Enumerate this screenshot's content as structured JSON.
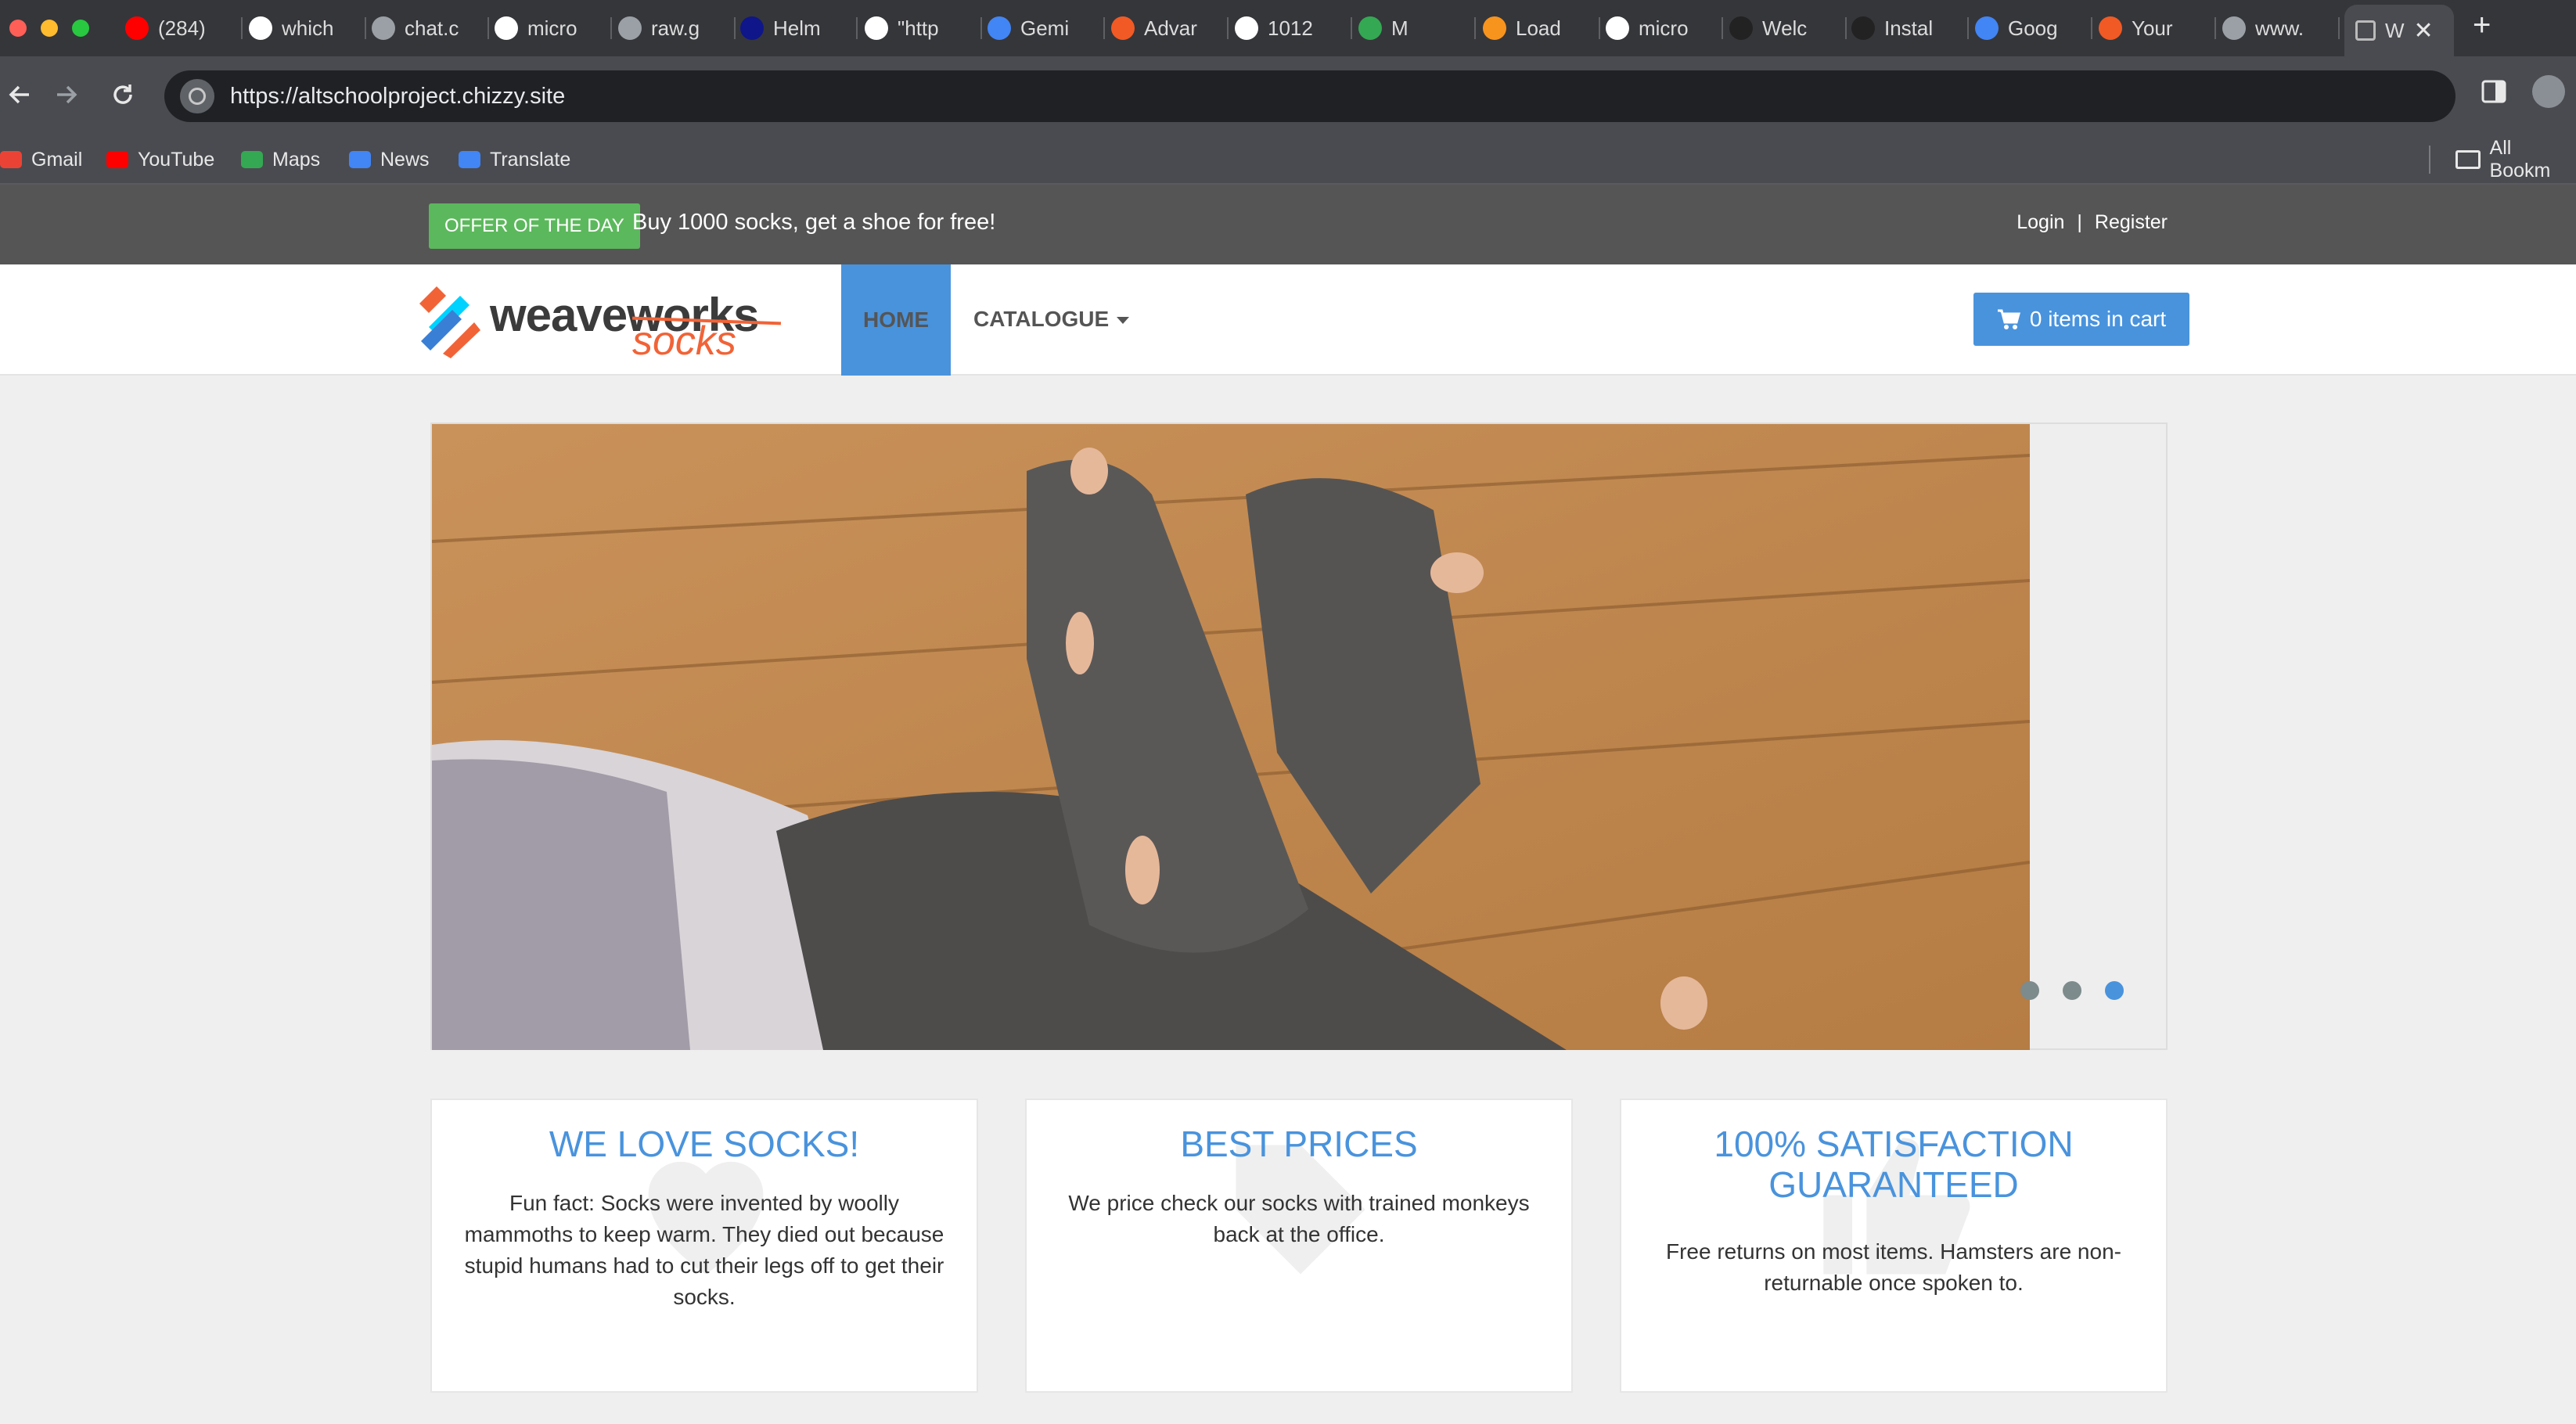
{
  "browser": {
    "tabs": [
      {
        "label": "(284)",
        "icon": "youtube-icon",
        "color": "#ff0000"
      },
      {
        "label": "which",
        "icon": "google-icon",
        "color": "#ffffff"
      },
      {
        "label": "chat.c",
        "icon": "globe-icon",
        "color": "#9aa0a6"
      },
      {
        "label": "micro",
        "icon": "github-icon",
        "color": "#ffffff"
      },
      {
        "label": "raw.g",
        "icon": "globe-icon",
        "color": "#9aa0a6"
      },
      {
        "label": "Helm",
        "icon": "helm-icon",
        "color": "#0f1689"
      },
      {
        "label": "\"http",
        "icon": "google-icon",
        "color": "#ffffff"
      },
      {
        "label": "Gemi",
        "icon": "gemini-icon",
        "color": "#4285f4"
      },
      {
        "label": "Advar",
        "icon": "app-icon",
        "color": "#f15a24"
      },
      {
        "label": "1012",
        "icon": "google-icon",
        "color": "#ffffff"
      },
      {
        "label": "M",
        "icon": "meet-icon",
        "color": "#34a853"
      },
      {
        "label": "Load",
        "icon": "app-icon",
        "color": "#f7941d"
      },
      {
        "label": "micro",
        "icon": "github-icon",
        "color": "#ffffff"
      },
      {
        "label": "Welc",
        "icon": "app-icon",
        "color": "#222222"
      },
      {
        "label": "Instal",
        "icon": "app-icon",
        "color": "#222222"
      },
      {
        "label": "Goog",
        "icon": "gcloud-icon",
        "color": "#4285f4"
      },
      {
        "label": "Your",
        "icon": "app-icon",
        "color": "#f15a24"
      },
      {
        "label": "www.",
        "icon": "globe-icon",
        "color": "#9aa0a6"
      }
    ],
    "active_tab": {
      "label": "W",
      "icon": "weaveworks-icon"
    },
    "new_tab_symbol": "+",
    "close_symbol": "✕",
    "url": "https://altschoolproject.chizzy.site",
    "bookmarks": [
      {
        "label": "Gmail",
        "icon": "gmail-icon",
        "color": "#ea4335"
      },
      {
        "label": "YouTube",
        "icon": "youtube-icon",
        "color": "#ff0000"
      },
      {
        "label": "Maps",
        "icon": "maps-icon",
        "color": "#34a853"
      },
      {
        "label": "News",
        "icon": "news-icon",
        "color": "#4285f4"
      },
      {
        "label": "Translate",
        "icon": "translate-icon",
        "color": "#4285f4"
      }
    ],
    "all_bookmarks": "All Bookm"
  },
  "site": {
    "offer_badge": "OFFER OF THE DAY",
    "offer_text": "Buy 1000 socks, get a shoe for free!",
    "login": "Login",
    "separator": "|",
    "register": "Register",
    "logo_primary": "weaveworks",
    "logo_secondary": "socks",
    "nav_home": "HOME",
    "nav_catalogue": "CATALOGUE",
    "cart_label": "0 items in cart",
    "carousel": {
      "slides": 3,
      "active": 3
    },
    "features": [
      {
        "title": "WE LOVE SOCKS!",
        "text": "Fun fact: Socks were invented by woolly mammoths to keep warm. They died out because stupid humans had to cut their legs off to get their socks."
      },
      {
        "title": "BEST PRICES",
        "text": "We price check our socks with trained monkeys back at the office."
      },
      {
        "title": "100% SATISFACTION GUARANTEED",
        "text": "Free returns on most items. Hamsters are non-returnable once spoken to."
      }
    ],
    "colors": {
      "accent": "#4993dd",
      "offer": "#5cb85c",
      "topbar": "#555555"
    }
  }
}
